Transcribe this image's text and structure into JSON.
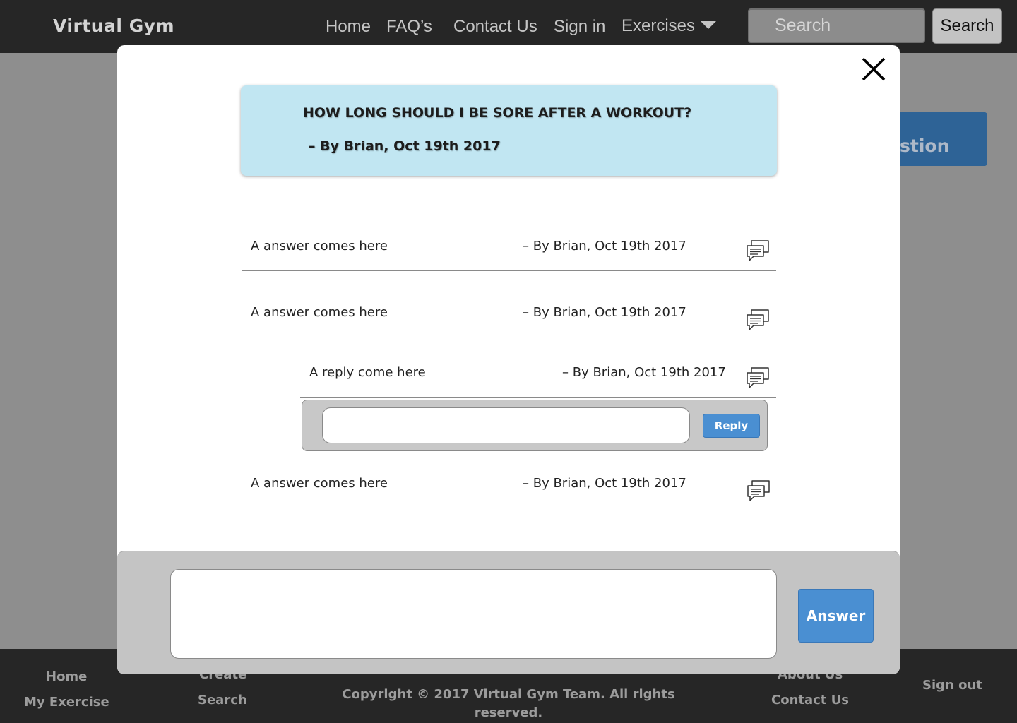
{
  "navbar": {
    "brand": "Virtual Gym",
    "links": [
      "Home",
      "FAQ’s",
      "Contact Us",
      "Sign in"
    ],
    "exercises_label": "Exercises",
    "search_placeholder": "Search",
    "search_button": "Search"
  },
  "background": {
    "add_question_label": "Add\nQuestion"
  },
  "footer": {
    "home": "Home",
    "my_exercise": "My Exercise",
    "create": "Create",
    "search": "Search",
    "copyright": "Copyright © 2017 Virtual Gym Team. All rights reserved.",
    "about_us": "About Us",
    "contact_us": "Contact Us",
    "sign_out": "Sign out"
  },
  "modal": {
    "question": {
      "title": "HOW LONG SHOULD I BE SORE AFTER A WORKOUT?",
      "author": "– By Brian, Oct 19th 2017"
    },
    "answers": [
      {
        "text": "A answer comes here",
        "meta": "– By Brian, Oct 19th 2017"
      },
      {
        "text": "A answer comes here",
        "meta": "– By Brian, Oct 19th 2017"
      },
      {
        "text": "A answer comes here",
        "meta": "– By Brian, Oct 19th 2017"
      }
    ],
    "reply": {
      "text": "A reply come here",
      "meta": "– By Brian, Oct 19th 2017"
    },
    "reply_input_value": "",
    "reply_button": "Reply",
    "answer_input_value": "",
    "answer_button": "Answer"
  },
  "icons": {
    "close": "close-icon",
    "comment": "chat-bubbles-icon",
    "dropdown": "caret-down-icon"
  }
}
